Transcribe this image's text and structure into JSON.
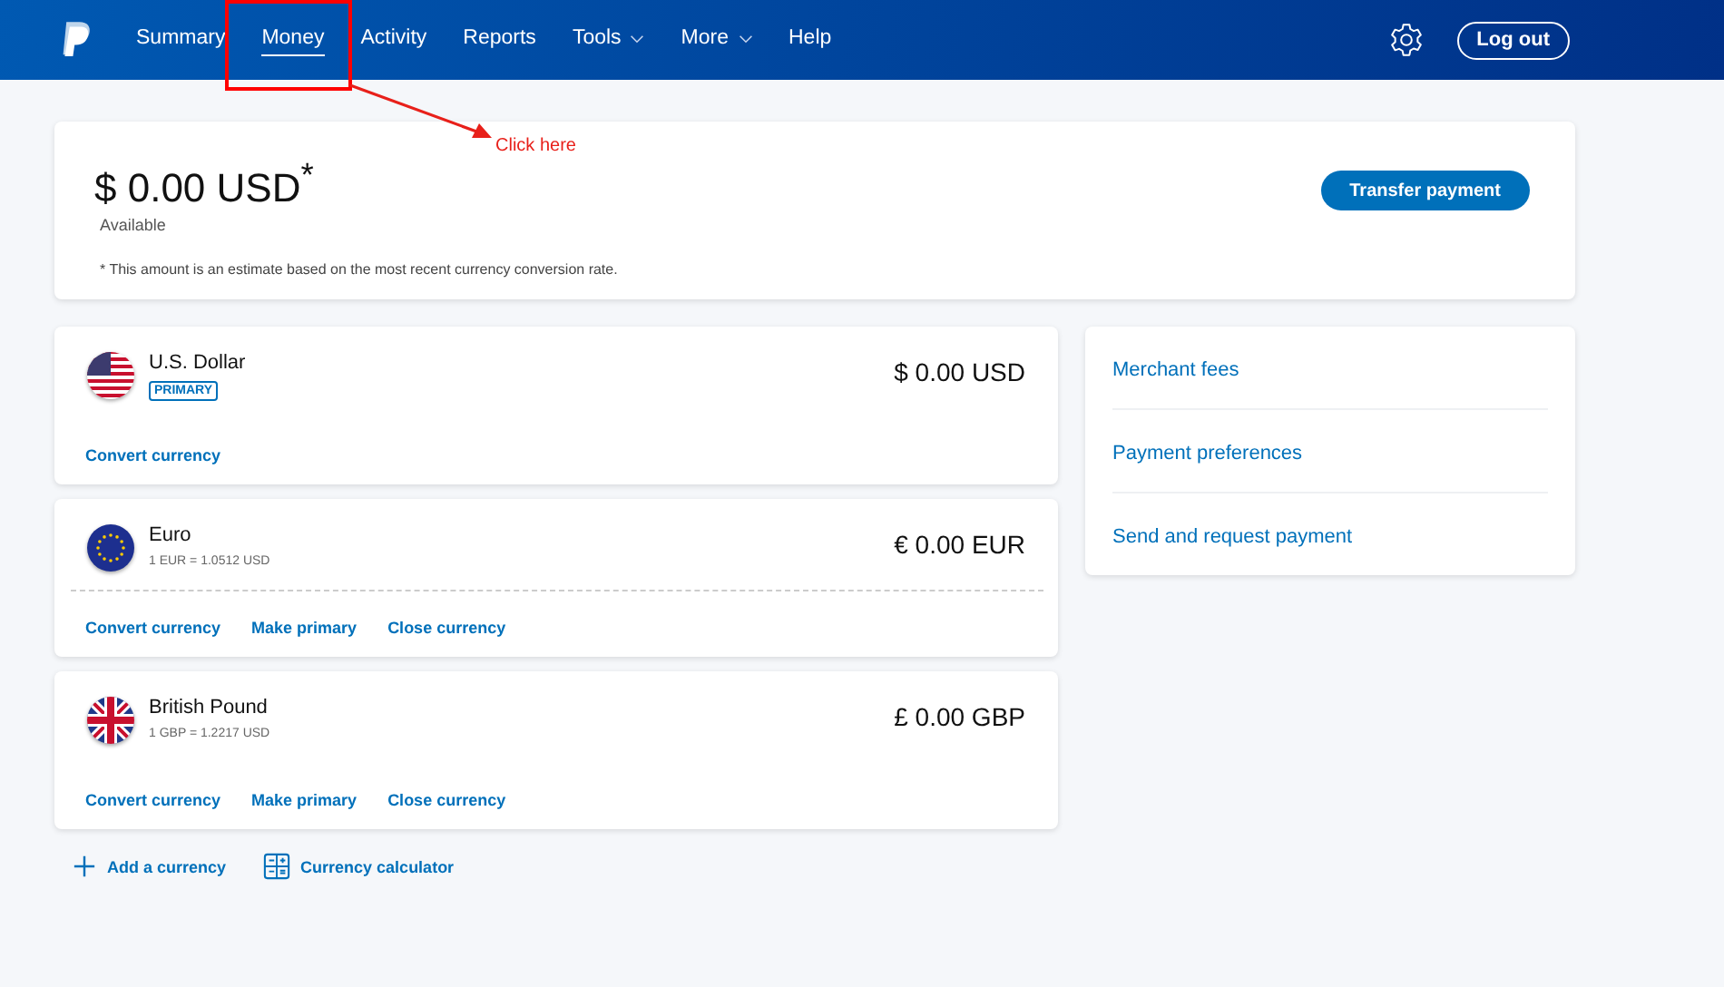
{
  "nav": {
    "items": [
      {
        "label": "Summary",
        "selected": false,
        "dropdown": false
      },
      {
        "label": "Money",
        "selected": true,
        "dropdown": false
      },
      {
        "label": "Activity",
        "selected": false,
        "dropdown": false
      },
      {
        "label": "Reports",
        "selected": false,
        "dropdown": false
      },
      {
        "label": "Tools",
        "selected": false,
        "dropdown": true
      },
      {
        "label": "More",
        "selected": false,
        "dropdown": true
      },
      {
        "label": "Help",
        "selected": false,
        "dropdown": false
      }
    ],
    "logout": "Log out"
  },
  "annotation": {
    "label": "Click here"
  },
  "balance": {
    "amount": "$ 0.00 USD$^{*}$",
    "caption": "Available",
    "note": "* This amount is an estimate based on the most recent currency conversion rate.",
    "button": "Transfer payment"
  },
  "currencies": [
    {
      "kind": "us",
      "name": "U.S. Dollar",
      "badge": "PRIMARY",
      "amount": "$ 0.00 USD",
      "dashed_divider": false,
      "actions": [
        "Convert currency"
      ]
    },
    {
      "kind": "eu",
      "name": "Euro",
      "rate": "1 EUR = 1.0512 USD",
      "amount": "€ 0.00 EUR",
      "dashed_divider": true,
      "actions": [
        "Convert currency",
        "Make primary",
        "Close currency"
      ]
    },
    {
      "kind": "uk",
      "name": "British Pound",
      "rate": "1 GBP = 1.2217 USD",
      "amount": "£ 0.00 GBP",
      "dashed_divider": false,
      "actions": [
        "Convert currency",
        "Make primary",
        "Close currency"
      ]
    }
  ],
  "footer_links": [
    {
      "kind": "add",
      "label": "Add a currency"
    },
    {
      "kind": "calculator",
      "label": "Currency calculator"
    }
  ],
  "side_links": [
    "Merchant fees",
    "Payment preferences",
    "Send and request payment"
  ]
}
